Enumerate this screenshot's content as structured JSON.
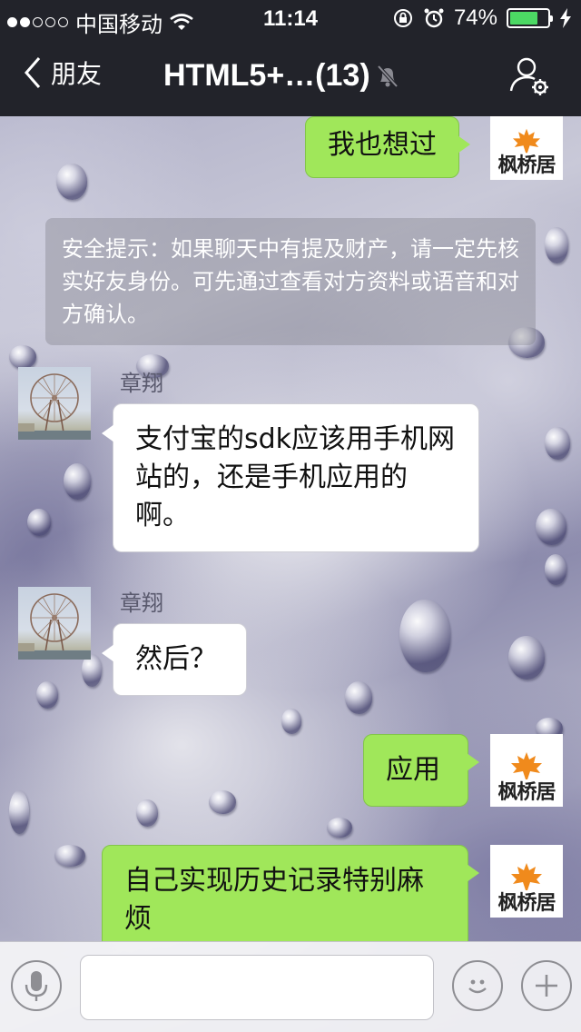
{
  "status_bar": {
    "carrier": "中国移动",
    "time": "11:14",
    "battery": "74%",
    "battery_level": 0.74
  },
  "nav": {
    "back_label": "朋友",
    "title": "HTML5+…(13)"
  },
  "messages": [
    {
      "side": "right",
      "avatar": "枫桥居",
      "text": "我也想过"
    },
    {
      "side": "system",
      "text": "安全提示：如果聊天中有提及财产，请一定先核实好友身份。可先通过查看对方资料或语音和对方确认。"
    },
    {
      "side": "left",
      "sender": "章翔",
      "text": "支付宝的sdk应该用手机网站的，还是手机应用的啊。"
    },
    {
      "side": "left",
      "sender": "章翔",
      "text": "然后？"
    },
    {
      "side": "right",
      "avatar": "枫桥居",
      "text": "应用"
    },
    {
      "side": "right",
      "avatar": "枫桥居",
      "text": "自己实现历史记录特别麻烦"
    }
  ],
  "input": {
    "value": "",
    "placeholder": ""
  },
  "colors": {
    "bar_bg": "#22232a",
    "green_bubble": "#a0e75a",
    "battery_green": "#4cd964",
    "maple_orange": "#f08a1c"
  },
  "icons": {
    "back": "chevron-left-icon",
    "mute": "bell-slash-icon",
    "group_settings": "person-gear-icon",
    "voice": "microphone-icon",
    "emoji": "smiley-icon",
    "more": "plus-icon"
  }
}
